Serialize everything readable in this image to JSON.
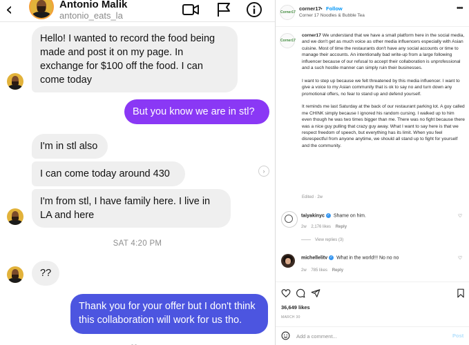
{
  "dm": {
    "header": {
      "name": "Antonio Malik",
      "handle": "antonio_eats_la",
      "icons": [
        "back-icon",
        "video-call-icon",
        "flag-icon",
        "info-icon"
      ]
    },
    "messages": [
      {
        "from": "them",
        "text": "Hello! I wanted to record the food being made and post it on my page. In exchange for $100 off the food. I can come today"
      },
      {
        "from": "me",
        "text": "But you know we are in stl?"
      },
      {
        "from": "them",
        "text": "I'm in stl also"
      },
      {
        "from": "them",
        "text": "I can come today around 430"
      },
      {
        "from": "them",
        "text": "I'm from stl, I have family here. I live in LA and here"
      },
      {
        "from": "them",
        "text": "??"
      },
      {
        "from": "me",
        "text": "Thank you for your offer but I don't think this collaboration will work for us tho."
      }
    ],
    "timestamp": "SAT 4:20 PM",
    "colors": {
      "purple_bubble": "#8a38f5",
      "blue_bubble": "#4c55e0",
      "incoming_bubble": "#efefef"
    }
  },
  "post": {
    "logo_text": "Corner17",
    "username": "corner17",
    "dot": "•",
    "follow": "Follow",
    "location": "Corner 17 Noodles & Bubble Tea",
    "more": "•••",
    "caption_user": "corner17",
    "caption_p1": "We understand that we have a small platform here in the social media, and we don't get as much voice as other media influencers especially with Asian cuisine. Most of time the restaurants don't have any social accounts or time to manage their accounts. An intentionally bad write-up from a large following influencer because of our refusal to accept their collaboration is unprofessional and a such hostile manner can simply ruin their businesses.",
    "caption_p2": "I want to step up because we felt threatened by this media influencer. I want to give a voice to my Asian community that is ok to say no and turn down any promotional offers, no fear to stand up and defend yourself.",
    "caption_p3": "It reminds me last Saturday at the back of our restaurant parking lot. A guy called me CHINK simply because I ignored his random cursing. I walked up to him even though he was two times bigger than me. There was no fight because there was a nice guy pulling that crazy guy away. What I want to say here is that we respect freedom of speech, but everything has its limit. When you feel disrespectful from anyone anytime, we should all stand up to fight for yourself and the community.",
    "edited": "Edited · 2w",
    "comments": [
      {
        "user": "taiyakinyc",
        "text": "Shame on him.",
        "age": "2w",
        "likes": "2,176 likes",
        "reply": "Reply",
        "view_replies": "View replies (3)"
      },
      {
        "user": "michellelitv",
        "text": "What in the world!!! No no no",
        "age": "2w",
        "likes": "785 likes",
        "reply": "Reply"
      }
    ],
    "likes": "36,649 likes",
    "date": "MARCH 30",
    "comment_placeholder": "Add a comment...",
    "post_button": "Post",
    "colors": {
      "follow": "#0095f6",
      "verified": "#3897f0",
      "post_button": "#b2dffc"
    }
  }
}
